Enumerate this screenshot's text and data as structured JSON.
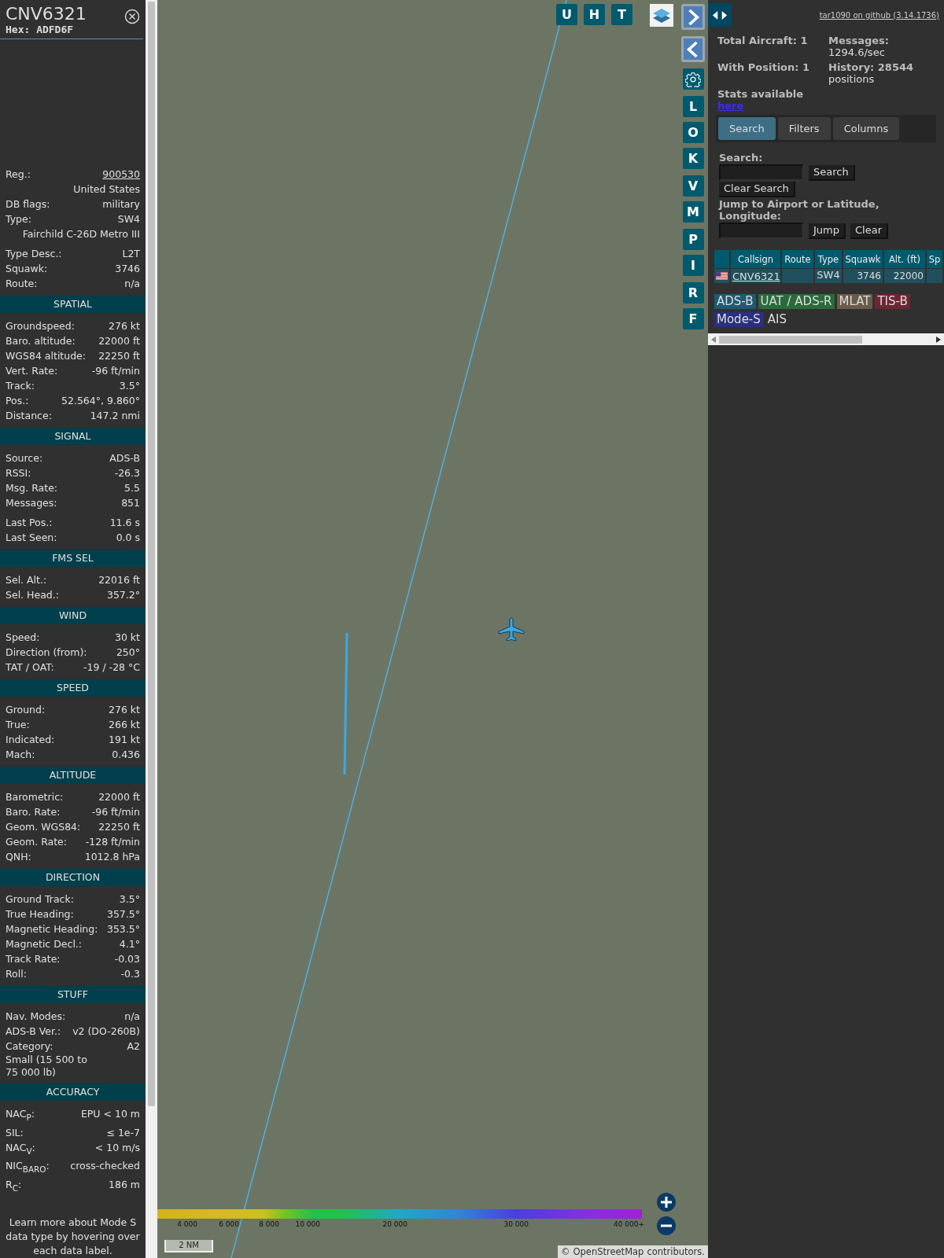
{
  "info_panel": {
    "callsign": "CNV6321",
    "hex": "Hex: ADFD6F",
    "rows": [
      {
        "label": "Reg.:",
        "value": "900530",
        "link": true
      },
      {
        "value": "United States"
      },
      {
        "label": "DB flags:",
        "value": "military"
      },
      {
        "label": "Type:",
        "value": "SW4"
      },
      {
        "value": "Fairchild C-26D Metro III"
      },
      {
        "label": "Type Desc.:",
        "value": "L2T",
        "gap_before": true
      },
      {
        "label": "Squawk:",
        "value": "3746"
      },
      {
        "label": "Route:",
        "value": "n/a"
      }
    ],
    "sections": [
      {
        "title": "SPATIAL",
        "rows": [
          {
            "label": "Groundspeed:",
            "value": "276 kt"
          },
          {
            "label": "Baro. altitude:",
            "value": "22000 ft"
          },
          {
            "label": "WGS84 altitude:",
            "value": "22250 ft"
          },
          {
            "label": "Vert. Rate:",
            "value": "-96 ft/min"
          },
          {
            "label": "Track:",
            "value": "3.5°"
          },
          {
            "label": "Pos.:",
            "value": "52.564°, 9.860°"
          },
          {
            "label": "Distance:",
            "value": "147.2 nmi"
          }
        ]
      },
      {
        "title": "SIGNAL",
        "rows": [
          {
            "label": "Source:",
            "value": "ADS-B"
          },
          {
            "label": "RSSI:",
            "value": "-26.3"
          },
          {
            "label": "Msg. Rate:",
            "value": "5.5"
          },
          {
            "label": "Messages:",
            "value": "851"
          },
          {
            "label": "Last Pos.:",
            "value": "11.6 s",
            "gap_before": true
          },
          {
            "label": "Last Seen:",
            "value": "0.0 s"
          }
        ]
      },
      {
        "title": "FMS SEL",
        "rows": [
          {
            "label": "Sel. Alt.:",
            "value": "22016 ft"
          },
          {
            "label": "Sel. Head.:",
            "value": "357.2°"
          }
        ]
      },
      {
        "title": "WIND",
        "rows": [
          {
            "label": "Speed:",
            "value": "30 kt"
          },
          {
            "label": "Direction (from):",
            "value": "250°"
          },
          {
            "label": "TAT / OAT:",
            "value": "-19 / -28 °C"
          }
        ]
      },
      {
        "title": "SPEED",
        "rows": [
          {
            "label": "Ground:",
            "value": "276 kt"
          },
          {
            "label": "True:",
            "value": "266 kt"
          },
          {
            "label": "Indicated:",
            "value": "191 kt"
          },
          {
            "label": "Mach:",
            "value": "0.436"
          }
        ]
      },
      {
        "title": "ALTITUDE",
        "rows": [
          {
            "label": "Barometric:",
            "value": "22000 ft"
          },
          {
            "label": "Baro. Rate:",
            "value": "-96 ft/min"
          },
          {
            "label": "Geom. WGS84:",
            "value": "22250 ft"
          },
          {
            "label": "Geom. Rate:",
            "value": "-128 ft/min"
          },
          {
            "label": "QNH:",
            "value": "1012.8 hPa"
          }
        ]
      },
      {
        "title": "DIRECTION",
        "rows": [
          {
            "label": "Ground Track:",
            "value": "3.5°"
          },
          {
            "label": "True Heading:",
            "value": "357.5°"
          },
          {
            "label": "Magnetic Heading:",
            "value": "353.5°"
          },
          {
            "label": "Magnetic Decl.:",
            "value": "4.1°"
          },
          {
            "label": "Track Rate:",
            "value": "-0.03"
          },
          {
            "label": "Roll:",
            "value": "-0.3"
          }
        ]
      },
      {
        "title": "STUFF",
        "rows": [
          {
            "label": "Nav. Modes:",
            "value": "n/a"
          },
          {
            "label": "ADS-B Ver.:",
            "value": "v2 (DO-260B)"
          },
          {
            "label": "Category:",
            "value": "A2"
          },
          {
            "label": "Small (15 500 to 75 000 lb)"
          }
        ]
      },
      {
        "title": "ACCURACY",
        "rows": [
          {
            "label": "NAC$_{P}$:",
            "value": "EPU < 10 m"
          },
          {
            "label": "SIL:",
            "value": "≤ 1e-7"
          },
          {
            "label": "NAC$_{V}$:",
            "value": "< 10 m/s"
          },
          {
            "label": "NIC$_{BARO}$:",
            "value": "cross-checked"
          },
          {
            "label": "R$_{C}$:",
            "value": "186 m"
          }
        ]
      }
    ],
    "note": "Learn more about Mode S data type by hovering over each data label."
  },
  "map": {
    "top_buttons": [
      "U",
      "H",
      "T"
    ],
    "side_groups": [
      [
        "L",
        "O",
        "K"
      ],
      [
        "V",
        "M"
      ],
      [
        "P",
        "I"
      ],
      [
        "R",
        "F"
      ]
    ],
    "altitude_legend": [
      "4 000",
      "6 000",
      "8 000",
      "10 000",
      "20 000",
      "30 000",
      "40 000+"
    ],
    "scale": "2 NM",
    "attribution_prefix": "©",
    "attribution_link": "OpenStreetMap",
    "attribution_suffix": "contributors."
  },
  "side_panel": {
    "github_link": "tar1090 on github (3.14.1736)",
    "stats": [
      {
        "label": "Total Aircraft: 1"
      },
      {
        "label": "Messages:",
        "value": "1294.6/sec"
      },
      {
        "label": "With Position: 1"
      },
      {
        "label": "History: 28544",
        "value": "positions"
      }
    ],
    "stats_text": "Stats available",
    "stats_link": "here",
    "tabs": [
      {
        "label": "Search",
        "selected": true
      },
      {
        "label": "Filters",
        "selected": false
      },
      {
        "label": "Columns",
        "selected": false
      }
    ],
    "search_label": "Search:",
    "search_button": "Search",
    "clear_search_button": "Clear Search",
    "jump_label": "Jump to Airport or Latitude, Longitude:",
    "jump_button": "Jump",
    "clear_button": "Clear",
    "table": {
      "columns": [
        {
          "label": "Callsign"
        },
        {
          "label": "Route"
        },
        {
          "label": "Type"
        },
        {
          "label": "Squawk"
        },
        {
          "label": "Alt. (ft)"
        },
        {
          "label": "Sp"
        }
      ],
      "rows": [
        {
          "callsign": "CNV6321",
          "type": "SW4",
          "squawk": "3746",
          "altitude": "22000"
        }
      ]
    },
    "sources": [
      {
        "label": "ADS-B",
        "color": "#1e5a73"
      },
      {
        "label": "UAT / ADS-R",
        "color": "#2a6b3a"
      },
      {
        "label": "MLAT",
        "color": "#6b5c49"
      },
      {
        "label": "TIS-B",
        "color": "#6e2633"
      },
      {
        "label": "Mode-S",
        "color": "#2a2f80"
      },
      {
        "label": "AIS"
      }
    ]
  }
}
